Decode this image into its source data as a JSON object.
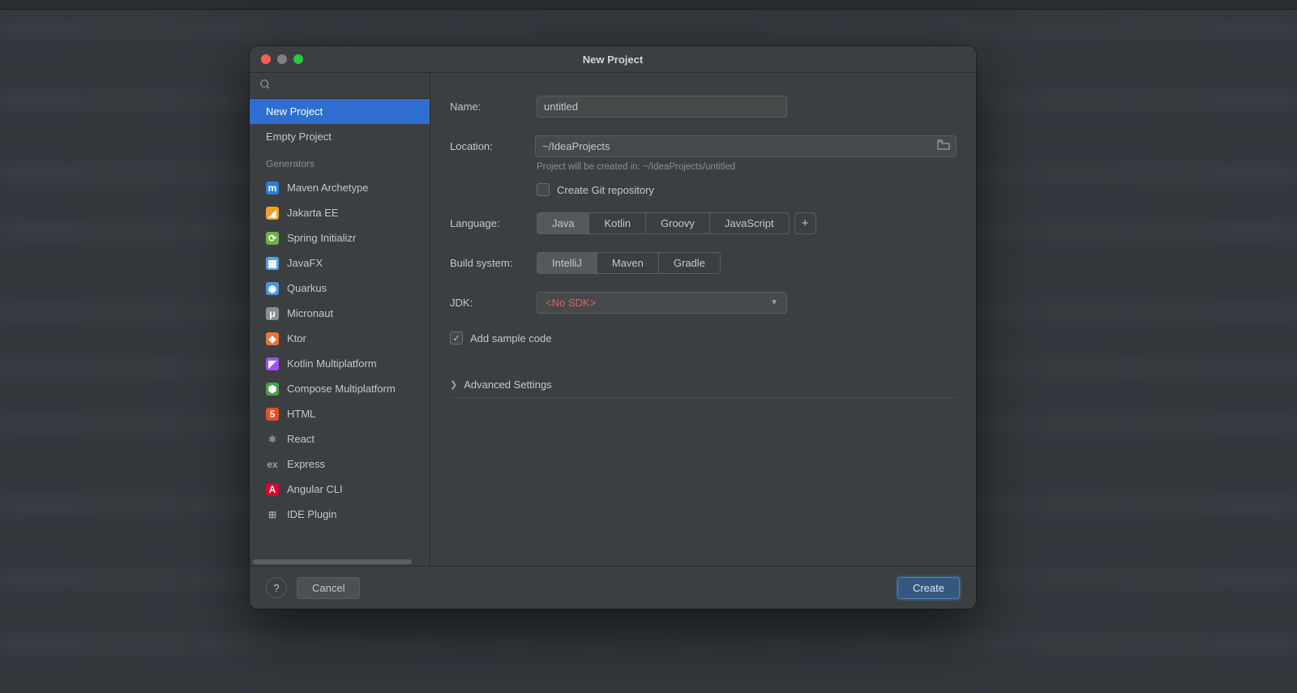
{
  "title": "New Project",
  "sidebar": {
    "search_placeholder": "",
    "items_top": [
      {
        "label": "New Project",
        "selected": true
      },
      {
        "label": "Empty Project",
        "selected": false
      }
    ],
    "generators_header": "Generators",
    "generators": [
      {
        "label": "Maven Archetype",
        "icon_bg": "#2f7fd2",
        "icon_txt": "m"
      },
      {
        "label": "Jakarta EE",
        "icon_bg": "#f0a030",
        "icon_txt": "◢"
      },
      {
        "label": "Spring Initializr",
        "icon_bg": "#6db33f",
        "icon_txt": "⟳"
      },
      {
        "label": "JavaFX",
        "icon_bg": "#5aa0e0",
        "icon_txt": "▦"
      },
      {
        "label": "Quarkus",
        "icon_bg": "#4695eb",
        "icon_txt": "◉"
      },
      {
        "label": "Micronaut",
        "icon_bg": "#8a8f94",
        "icon_txt": "μ"
      },
      {
        "label": "Ktor",
        "icon_bg": "#f07030",
        "icon_txt": "◆"
      },
      {
        "label": "Kotlin Multiplatform",
        "icon_bg": "#a050f0",
        "icon_txt": "◤"
      },
      {
        "label": "Compose Multiplatform",
        "icon_bg": "#4aa050",
        "icon_txt": "⬢"
      },
      {
        "label": "HTML",
        "icon_bg": "#e44d26",
        "icon_txt": "5"
      },
      {
        "label": "React",
        "icon_bg": "transparent",
        "icon_txt": "⚛"
      },
      {
        "label": "Express",
        "icon_bg": "transparent",
        "icon_txt": "ex"
      },
      {
        "label": "Angular CLI",
        "icon_bg": "#dd0031",
        "icon_txt": "A"
      },
      {
        "label": "IDE Plugin",
        "icon_bg": "transparent",
        "icon_txt": "⊞"
      }
    ]
  },
  "form": {
    "name_label": "Name:",
    "name_value": "untitled",
    "location_label": "Location:",
    "location_value": "~/IdeaProjects",
    "location_hint": "Project will be created in: ~/IdeaProjects/untitled",
    "git_label": "Create Git repository",
    "git_checked": false,
    "language_label": "Language:",
    "languages": [
      {
        "label": "Java",
        "active": true
      },
      {
        "label": "Kotlin",
        "active": false
      },
      {
        "label": "Groovy",
        "active": false
      },
      {
        "label": "JavaScript",
        "active": false
      }
    ],
    "build_label": "Build system:",
    "builds": [
      {
        "label": "IntelliJ",
        "active": true
      },
      {
        "label": "Maven",
        "active": false
      },
      {
        "label": "Gradle",
        "active": false
      }
    ],
    "jdk_label": "JDK:",
    "jdk_value": "<No SDK>",
    "sample_label": "Add sample code",
    "sample_checked": true,
    "advanced_label": "Advanced Settings"
  },
  "footer": {
    "cancel": "Cancel",
    "create": "Create"
  }
}
